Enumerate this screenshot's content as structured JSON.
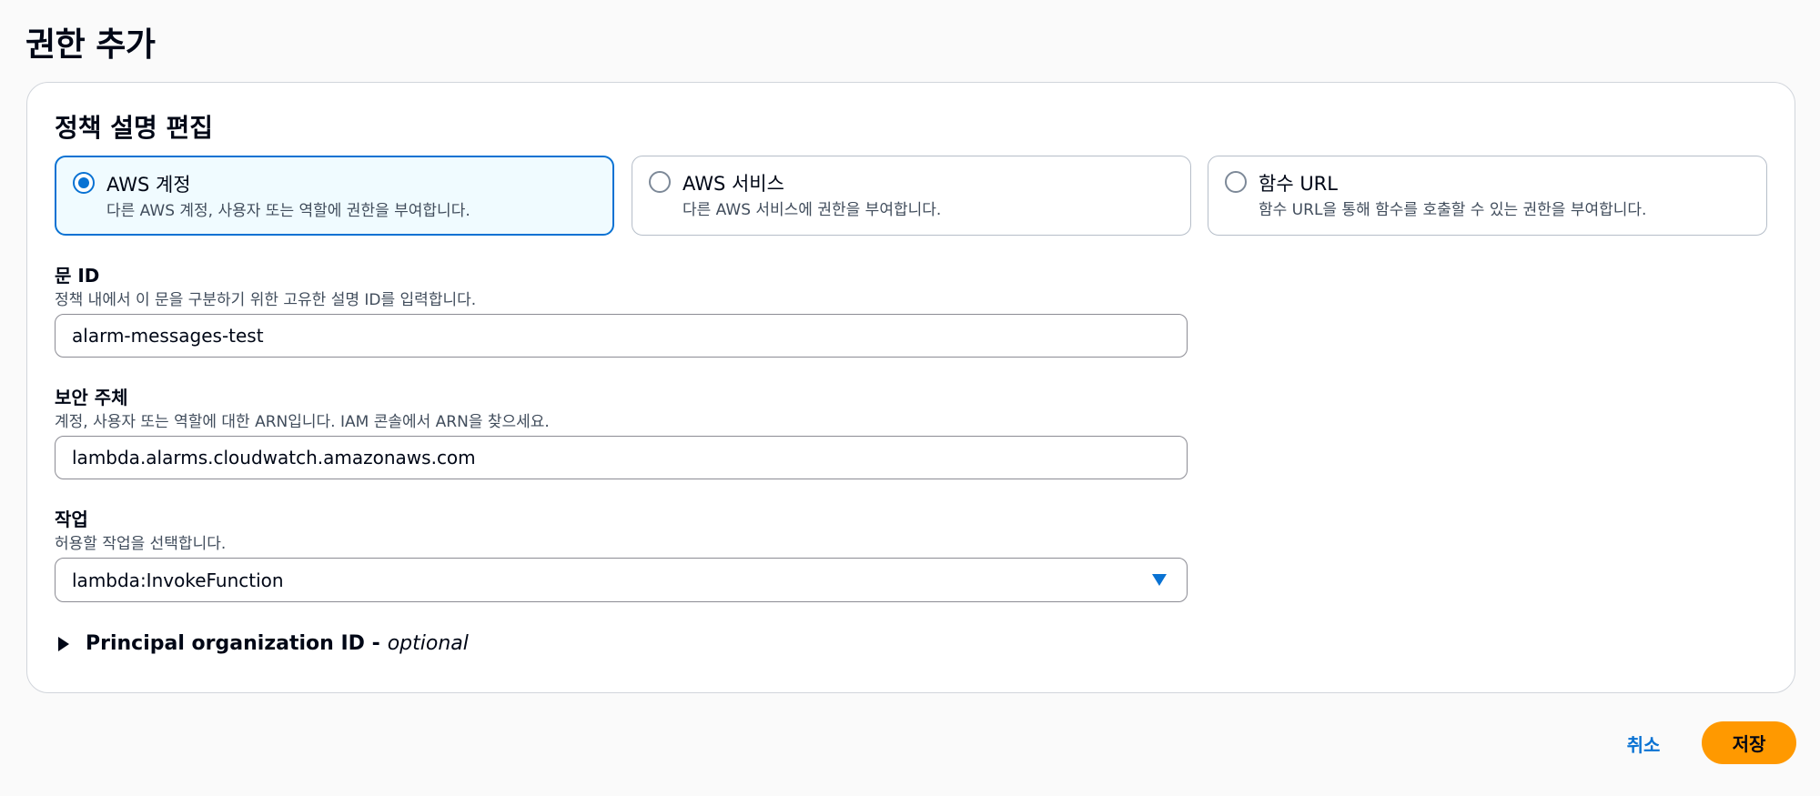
{
  "page": {
    "title": "권한 추가"
  },
  "policy": {
    "section_title": "정책 설명 편집",
    "options": [
      {
        "label": "AWS 계정",
        "description": "다른 AWS 계정, 사용자 또는 역할에 권한을 부여합니다.",
        "selected": true
      },
      {
        "label": "AWS 서비스",
        "description": "다른 AWS 서비스에 권한을 부여합니다.",
        "selected": false
      },
      {
        "label": "함수 URL",
        "description": "함수 URL을 통해 함수를 호출할 수 있는 권한을 부여합니다.",
        "selected": false
      }
    ]
  },
  "statement_id": {
    "label": "문 ID",
    "description": "정책 내에서 이 문을 구분하기 위한 고유한 설명 ID를 입력합니다.",
    "value": "alarm-messages-test"
  },
  "principal": {
    "label": "보안 주체",
    "description": "계정, 사용자 또는 역할에 대한 ARN입니다. IAM 콘솔에서 ARN을 찾으세요.",
    "value": "lambda.alarms.cloudwatch.amazonaws.com"
  },
  "action": {
    "label": "작업",
    "description": "허용할 작업을 선택합니다.",
    "selected_value": "lambda:InvokeFunction",
    "caret_icon": "caret-down-icon"
  },
  "principal_org": {
    "label": "Principal organization ID -",
    "optional": "optional",
    "icon": "caret-right-icon"
  },
  "footer": {
    "cancel_label": "취소",
    "save_label": "저장"
  },
  "colors": {
    "accent": "#0972d3",
    "primary_button": "#ff9900",
    "selected_tile_bg": "#f0fbff"
  }
}
